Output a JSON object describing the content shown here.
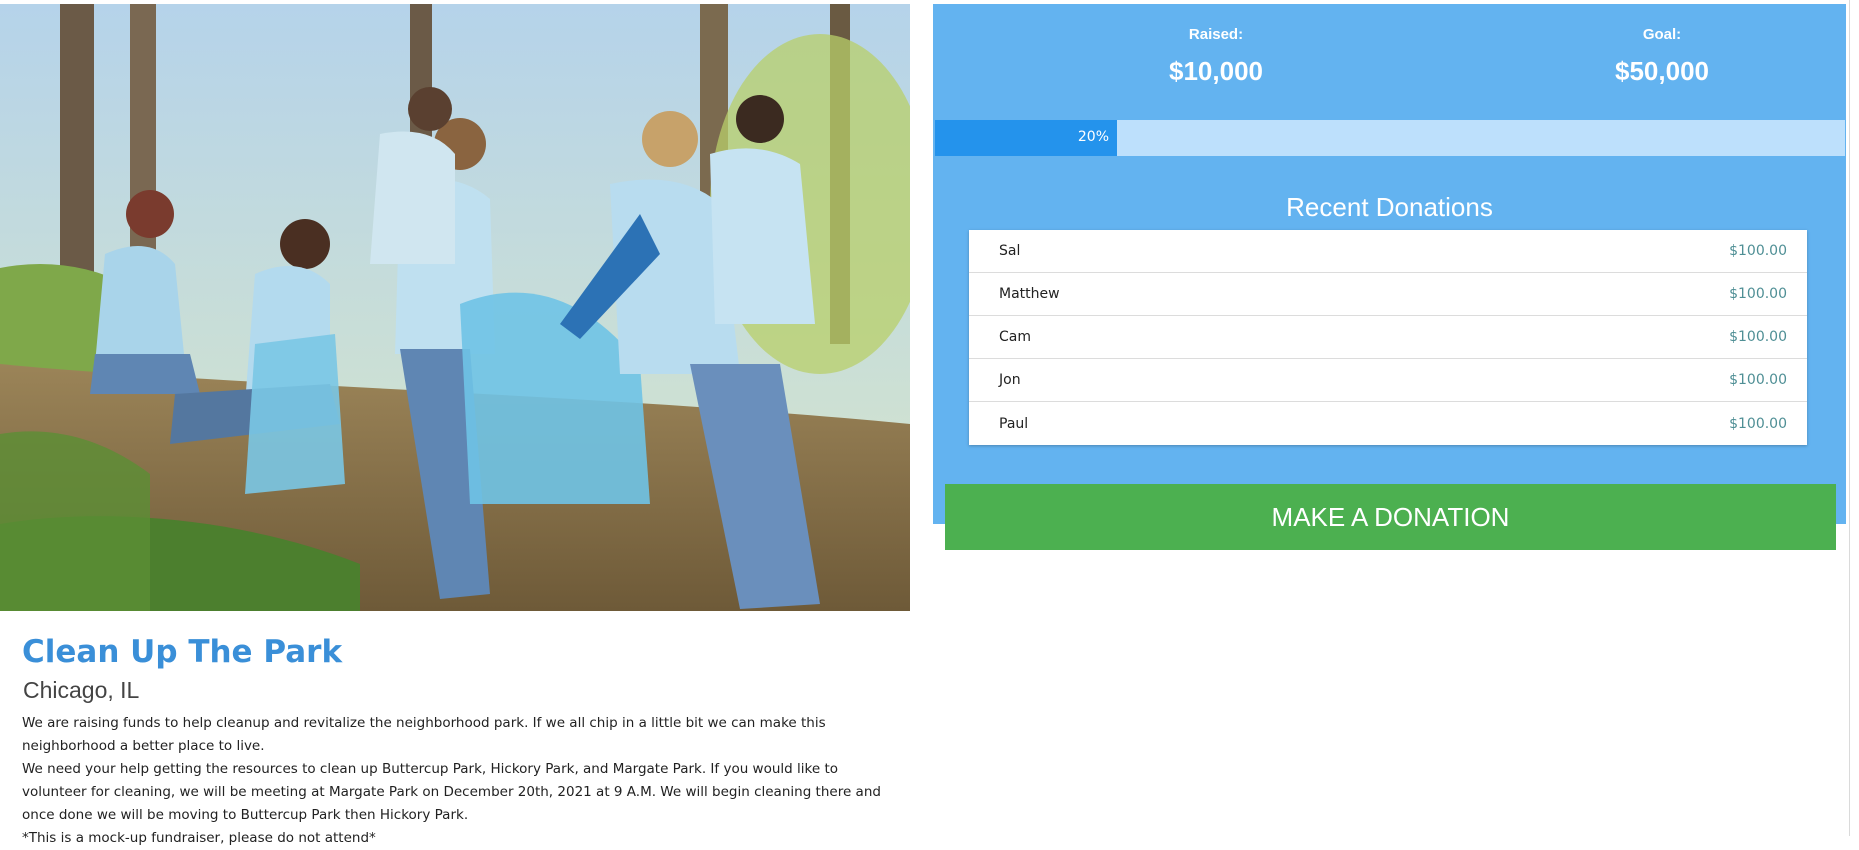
{
  "hero": {
    "image_subject": "volunteers collecting litter into blue bags in a park"
  },
  "campaign": {
    "title": "Clean Up The Park",
    "location": "Chicago, IL",
    "paragraphs": [
      "We are raising funds to help cleanup and revitalize the neighborhood park. If we all chip in a little bit we can make this neighborhood a better place to live.",
      "We need your help getting the resources to clean up Buttercup Park, Hickory Park, and Margate Park. If you would like to volunteer for cleaning, we will be meeting at Margate Park on December 20th, 2021 at 9 A.M. We will begin cleaning there and once done we will be moving to Buttercup Park then Hickory Park.",
      "*This is a mock-up fundraiser, please do not attend*"
    ]
  },
  "stats": {
    "raised_label": "Raised:",
    "raised_value": "$10,000",
    "goal_label": "Goal:",
    "goal_value": "$50,000"
  },
  "progress": {
    "percent": 20,
    "label": "20%"
  },
  "recent": {
    "title": "Recent Donations",
    "donations": [
      {
        "name": "Sal",
        "amount": "$100.00"
      },
      {
        "name": "Matthew",
        "amount": "$100.00"
      },
      {
        "name": "Cam",
        "amount": "$100.00"
      },
      {
        "name": "Jon",
        "amount": "$100.00"
      },
      {
        "name": "Paul",
        "amount": "$100.00"
      }
    ]
  },
  "cta": {
    "donate_label": "MAKE A DONATION"
  },
  "colors": {
    "panel": "#63b3f0",
    "progress_fill": "#2493ec",
    "progress_track": "#bde0fc",
    "donate_button": "#4cb050",
    "title": "#3a8fd8"
  }
}
